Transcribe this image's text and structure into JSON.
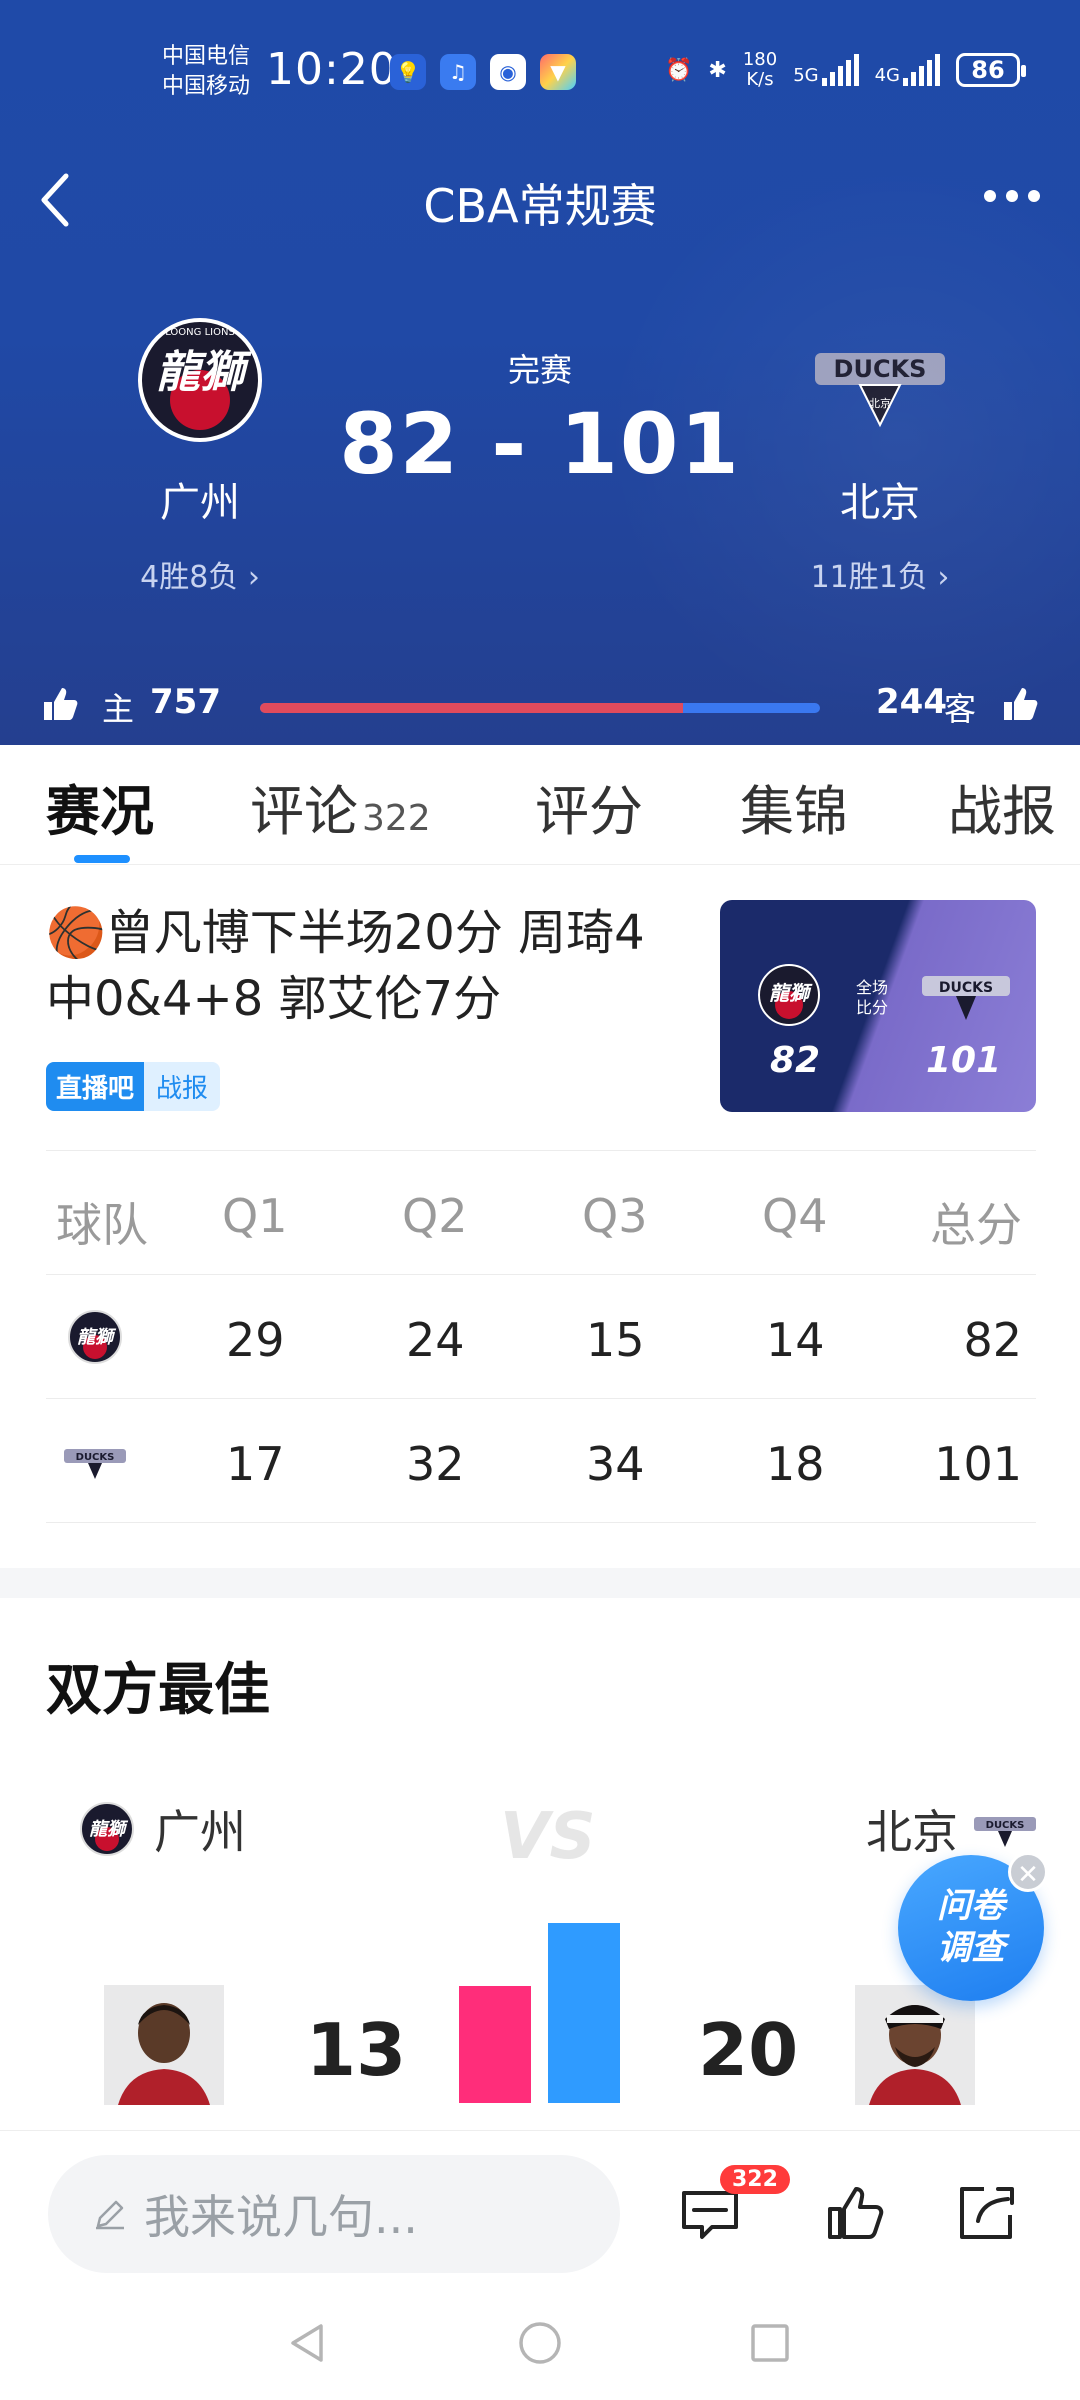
{
  "status_bar": {
    "carrier_1": "中国电信",
    "carrier_2": "中国移动",
    "time": "10:20",
    "speed_value": "180",
    "speed_unit": "K/s",
    "net_1": "5G",
    "net_2": "4G",
    "battery": "86"
  },
  "nav": {
    "title": "CBA常规赛"
  },
  "match": {
    "status": "完赛",
    "score": "82 - 101",
    "home": {
      "name": "广州",
      "record": "4胜8负",
      "logo_text": "龍獅",
      "logo_sub": "LOONG LIONS"
    },
    "away": {
      "name": "北京",
      "record": "11胜1负",
      "logo_text": "DUCKS",
      "logo_sub": "北京"
    }
  },
  "support": {
    "home_label": "主",
    "home_count": "757",
    "away_label": "客",
    "away_count": "244",
    "home_share": 0.756
  },
  "tabs": [
    {
      "label": "赛况",
      "active": true
    },
    {
      "label": "评论",
      "count": "322"
    },
    {
      "label": "评分"
    },
    {
      "label": "集锦"
    },
    {
      "label": "战报"
    }
  ],
  "news": {
    "title": "🏀曾凡博下半场20分 周琦4中0&4+8 郭艾伦7分",
    "tag_1": "直播吧",
    "tag_2": "战报",
    "thumb": {
      "home_score": "82",
      "away_score": "101",
      "mid_label_1": "全场",
      "mid_label_2": "比分",
      "home_logo": "龍獅",
      "away_logo": "DUCKS"
    }
  },
  "quarter_table": {
    "headers": [
      "球队",
      "Q1",
      "Q2",
      "Q3",
      "Q4",
      "总分"
    ],
    "rows": [
      {
        "team": "龍獅",
        "values": [
          "29",
          "24",
          "15",
          "14",
          "82"
        ]
      },
      {
        "team": "DUCKS",
        "values": [
          "17",
          "32",
          "34",
          "18",
          "101"
        ]
      }
    ]
  },
  "best": {
    "title": "双方最佳",
    "home_name": "广州",
    "away_name": "北京",
    "vs": "VS",
    "home_points": 13,
    "away_points": 20,
    "home_points_text": "13",
    "away_points_text": "20",
    "home_color": "#ff2d7a",
    "away_color": "#2f9bff"
  },
  "survey": {
    "line_1": "问卷",
    "line_2": "调查"
  },
  "bottom_bar": {
    "input_placeholder": "我来说几句...",
    "comment_badge": "322"
  },
  "colors": {
    "header_bg": "#2049a6",
    "accent": "#1e90ff",
    "home_bar": "#e04b5c",
    "away_bar": "#3a78f0"
  }
}
